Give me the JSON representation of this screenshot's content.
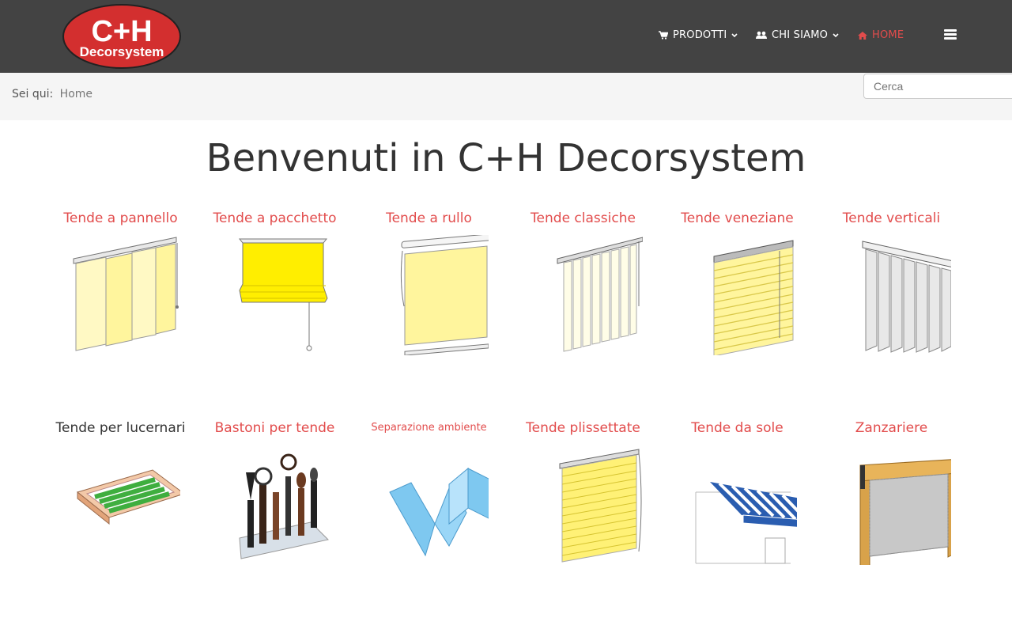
{
  "brand": {
    "logo_text_top": "C+H",
    "logo_text_bottom": "Decorsystem",
    "logo_color": "#d32f2f"
  },
  "nav": {
    "items": [
      {
        "label": "PRODOTTI",
        "icon": "cart-icon"
      },
      {
        "label": "CHI SIAMO",
        "icon": "users-icon"
      },
      {
        "label": "HOME",
        "icon": "home-icon",
        "active": true
      }
    ],
    "menu_icon": "hamburger-icon"
  },
  "breadcrumb": {
    "prefix": "Sei qui:",
    "current": "Home"
  },
  "search": {
    "placeholder": "Cerca"
  },
  "page": {
    "title": "Benvenuti in C+H Decorsystem"
  },
  "products": [
    {
      "label": "Tende a pannello"
    },
    {
      "label": "Tende a pacchetto"
    },
    {
      "label": "Tende a rullo"
    },
    {
      "label": "Tende classiche"
    },
    {
      "label": "Tende veneziane"
    },
    {
      "label": "Tende verticali"
    },
    {
      "label": "Tende per lucernari"
    },
    {
      "label": "Bastoni per tende"
    },
    {
      "label": "Separazione ambiente"
    },
    {
      "label": "Tende plissettate"
    },
    {
      "label": "Tende da sole"
    },
    {
      "label": "Zanzariere"
    }
  ],
  "colors": {
    "header_bg": "#434343",
    "accent": "#e24c4c",
    "crumb_bg": "#f5f5f5"
  }
}
